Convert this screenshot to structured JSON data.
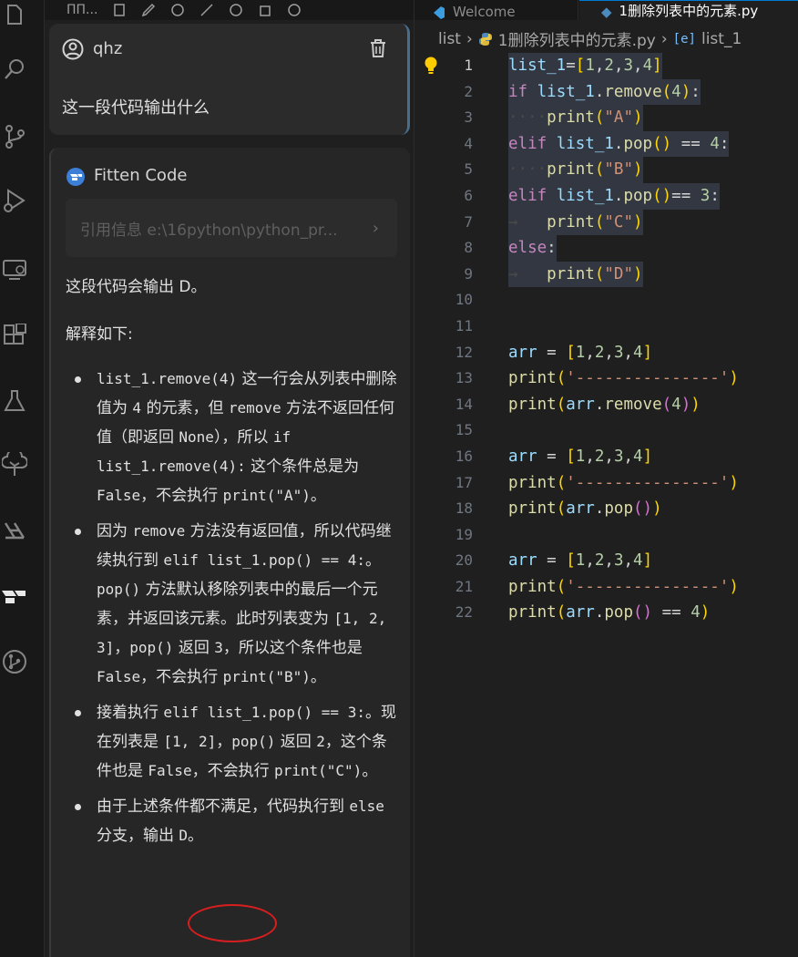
{
  "chat_toolbar": {
    "title": "ΠΠ..."
  },
  "user_card": {
    "name": "qhz",
    "message": "这一段代码输出什么"
  },
  "ai_card": {
    "name": "Fitten Code",
    "reference": "引用信息 e:\\16python\\python_pr...",
    "summary": "这段代码会输出 D。",
    "heading": "解释如下:",
    "bullets": [
      {
        "segments": [
          {
            "t": "list_1.remove(4)",
            "c": true
          },
          {
            "t": " 这一行会从列表中删除值为 "
          },
          {
            "t": "4",
            "c": true
          },
          {
            "t": " 的元素，但 "
          },
          {
            "t": "remove",
            "c": true
          },
          {
            "t": " 方法不返回任何值（即返回 "
          },
          {
            "t": "None",
            "c": true
          },
          {
            "t": "），所以 "
          },
          {
            "t": "if list_1.remove(4):",
            "c": true
          },
          {
            "t": " 这个条件总是为 "
          },
          {
            "t": "False",
            "c": true
          },
          {
            "t": "，不会执行 "
          },
          {
            "t": "print(\"A\")",
            "c": true
          },
          {
            "t": "。"
          }
        ]
      },
      {
        "segments": [
          {
            "t": "因为 "
          },
          {
            "t": "remove",
            "c": true
          },
          {
            "t": " 方法没有返回值，所以代码继续执行到 "
          },
          {
            "t": "elif list_1.pop() == 4:",
            "c": true
          },
          {
            "t": "。"
          },
          {
            "t": "pop()",
            "c": true
          },
          {
            "t": " 方法默认移除列表中的最后一个元素，并返回该元素。此时列表变为 "
          },
          {
            "t": "[1, 2, 3]",
            "c": true
          },
          {
            "t": "，"
          },
          {
            "t": "pop()",
            "c": true
          },
          {
            "t": " 返回 "
          },
          {
            "t": "3",
            "c": true
          },
          {
            "t": "，所以这个条件也是 "
          },
          {
            "t": "False",
            "c": true
          },
          {
            "t": "，不会执行 "
          },
          {
            "t": "print(\"B\")",
            "c": true
          },
          {
            "t": "。"
          }
        ]
      },
      {
        "segments": [
          {
            "t": "接着执行 "
          },
          {
            "t": "elif list_1.pop() == 3:",
            "c": true
          },
          {
            "t": "。现在列表是 "
          },
          {
            "t": "[1, 2]",
            "c": true
          },
          {
            "t": "，"
          },
          {
            "t": "pop()",
            "c": true
          },
          {
            "t": " 返回 "
          },
          {
            "t": "2",
            "c": true
          },
          {
            "t": "，这个条件也是 "
          },
          {
            "t": "False",
            "c": true
          },
          {
            "t": "，不会执行 "
          },
          {
            "t": "print(\"C\")",
            "c": true
          },
          {
            "t": "。"
          }
        ]
      },
      {
        "segments": [
          {
            "t": "由于上述条件都不满足，代码执行到 "
          },
          {
            "t": "else",
            "c": true
          },
          {
            "t": " 分支，输出 "
          },
          {
            "t": "D",
            "c": true
          },
          {
            "t": "。"
          }
        ]
      }
    ]
  },
  "editor": {
    "tabs": [
      "Welcome",
      "1删除列表中的元素.py"
    ],
    "breadcrumb": {
      "folder": "list",
      "file": "1删除列表中的元素.py",
      "symbol": "list_1"
    },
    "active_line": 1,
    "lines": [
      {
        "n": "1",
        "sel": true,
        "tokens": [
          [
            "v",
            "list_1"
          ],
          [
            "p",
            "="
          ],
          [
            "b1",
            "["
          ],
          [
            "n",
            "1"
          ],
          [
            "p",
            ","
          ],
          [
            "n",
            "2"
          ],
          [
            "p",
            ","
          ],
          [
            "n",
            "3"
          ],
          [
            "p",
            ","
          ],
          [
            "n",
            "4"
          ],
          [
            "b1",
            "]"
          ]
        ]
      },
      {
        "n": "2",
        "sel": true,
        "tokens": [
          [
            "k",
            "if"
          ],
          [
            "p",
            " "
          ],
          [
            "v",
            "list_1"
          ],
          [
            "p",
            "."
          ],
          [
            "f",
            "remove"
          ],
          [
            "b1",
            "("
          ],
          [
            "n",
            "4"
          ],
          [
            "b1",
            ")"
          ],
          [
            "p",
            ":"
          ]
        ]
      },
      {
        "n": "3",
        "sel": true,
        "tokens": [
          [
            "ws",
            "····"
          ],
          [
            "f",
            "print"
          ],
          [
            "b1",
            "("
          ],
          [
            "s",
            "\"A\""
          ],
          [
            "b1",
            ")"
          ]
        ]
      },
      {
        "n": "4",
        "sel": true,
        "tokens": [
          [
            "k",
            "elif"
          ],
          [
            "p",
            " "
          ],
          [
            "v",
            "list_1"
          ],
          [
            "p",
            "."
          ],
          [
            "f",
            "pop"
          ],
          [
            "b1",
            "("
          ],
          [
            "b1",
            ")"
          ],
          [
            "p",
            " == "
          ],
          [
            "n",
            "4"
          ],
          [
            "p",
            ":"
          ]
        ]
      },
      {
        "n": "5",
        "sel": true,
        "tokens": [
          [
            "ws",
            "····"
          ],
          [
            "f",
            "print"
          ],
          [
            "b1",
            "("
          ],
          [
            "s",
            "\"B\""
          ],
          [
            "b1",
            ")"
          ]
        ]
      },
      {
        "n": "6",
        "sel": true,
        "tokens": [
          [
            "k",
            "elif"
          ],
          [
            "p",
            " "
          ],
          [
            "v",
            "list_1"
          ],
          [
            "p",
            "."
          ],
          [
            "f",
            "pop"
          ],
          [
            "b1",
            "("
          ],
          [
            "b1",
            ")"
          ],
          [
            "p",
            "== "
          ],
          [
            "n",
            "3"
          ],
          [
            "p",
            ":"
          ]
        ]
      },
      {
        "n": "7",
        "sel": true,
        "tokens": [
          [
            "ws",
            "→   "
          ],
          [
            "f",
            "print"
          ],
          [
            "b1",
            "("
          ],
          [
            "s",
            "\"C\""
          ],
          [
            "b1",
            ")"
          ]
        ]
      },
      {
        "n": "8",
        "sel": true,
        "tokens": [
          [
            "k",
            "else"
          ],
          [
            "p",
            ":"
          ]
        ]
      },
      {
        "n": "9",
        "sel": true,
        "tokens": [
          [
            "ws",
            "→   "
          ],
          [
            "f",
            "print"
          ],
          [
            "b1",
            "("
          ],
          [
            "s",
            "\"D\""
          ],
          [
            "b1",
            ")"
          ]
        ]
      },
      {
        "n": "10",
        "sel": false,
        "tokens": []
      },
      {
        "n": "11",
        "sel": false,
        "tokens": []
      },
      {
        "n": "12",
        "sel": false,
        "tokens": [
          [
            "v",
            "arr"
          ],
          [
            "p",
            " = "
          ],
          [
            "b1",
            "["
          ],
          [
            "n",
            "1"
          ],
          [
            "p",
            ","
          ],
          [
            "n",
            "2"
          ],
          [
            "p",
            ","
          ],
          [
            "n",
            "3"
          ],
          [
            "p",
            ","
          ],
          [
            "n",
            "4"
          ],
          [
            "b1",
            "]"
          ]
        ]
      },
      {
        "n": "13",
        "sel": false,
        "tokens": [
          [
            "f",
            "print"
          ],
          [
            "b1",
            "("
          ],
          [
            "s",
            "'---------------'"
          ],
          [
            "b1",
            ")"
          ]
        ]
      },
      {
        "n": "14",
        "sel": false,
        "tokens": [
          [
            "f",
            "print"
          ],
          [
            "b1",
            "("
          ],
          [
            "v",
            "arr"
          ],
          [
            "p",
            "."
          ],
          [
            "f",
            "remove"
          ],
          [
            "b2",
            "("
          ],
          [
            "n",
            "4"
          ],
          [
            "b2",
            ")"
          ],
          [
            "b1",
            ")"
          ]
        ]
      },
      {
        "n": "15",
        "sel": false,
        "tokens": []
      },
      {
        "n": "16",
        "sel": false,
        "tokens": [
          [
            "v",
            "arr"
          ],
          [
            "p",
            " = "
          ],
          [
            "b1",
            "["
          ],
          [
            "n",
            "1"
          ],
          [
            "p",
            ","
          ],
          [
            "n",
            "2"
          ],
          [
            "p",
            ","
          ],
          [
            "n",
            "3"
          ],
          [
            "p",
            ","
          ],
          [
            "n",
            "4"
          ],
          [
            "b1",
            "]"
          ]
        ]
      },
      {
        "n": "17",
        "sel": false,
        "tokens": [
          [
            "f",
            "print"
          ],
          [
            "b1",
            "("
          ],
          [
            "s",
            "'---------------'"
          ],
          [
            "b1",
            ")"
          ]
        ]
      },
      {
        "n": "18",
        "sel": false,
        "tokens": [
          [
            "f",
            "print"
          ],
          [
            "b1",
            "("
          ],
          [
            "v",
            "arr"
          ],
          [
            "p",
            "."
          ],
          [
            "f",
            "pop"
          ],
          [
            "b2",
            "("
          ],
          [
            "b2",
            ")"
          ],
          [
            "b1",
            ")"
          ]
        ]
      },
      {
        "n": "19",
        "sel": false,
        "tokens": []
      },
      {
        "n": "20",
        "sel": false,
        "tokens": [
          [
            "v",
            "arr"
          ],
          [
            "p",
            " = "
          ],
          [
            "b1",
            "["
          ],
          [
            "n",
            "1"
          ],
          [
            "p",
            ","
          ],
          [
            "n",
            "2"
          ],
          [
            "p",
            ","
          ],
          [
            "n",
            "3"
          ],
          [
            "p",
            ","
          ],
          [
            "n",
            "4"
          ],
          [
            "b1",
            "]"
          ]
        ]
      },
      {
        "n": "21",
        "sel": false,
        "tokens": [
          [
            "f",
            "print"
          ],
          [
            "b1",
            "("
          ],
          [
            "s",
            "'---------------'"
          ],
          [
            "b1",
            ")"
          ]
        ]
      },
      {
        "n": "22",
        "sel": false,
        "tokens": [
          [
            "f",
            "print"
          ],
          [
            "b1",
            "("
          ],
          [
            "v",
            "arr"
          ],
          [
            "p",
            "."
          ],
          [
            "f",
            "pop"
          ],
          [
            "b2",
            "("
          ],
          [
            "b2",
            ")"
          ],
          [
            "p",
            " == "
          ],
          [
            "n",
            "4"
          ],
          [
            "b1",
            ")"
          ]
        ]
      }
    ]
  },
  "colors": {
    "accent": "#0078d4",
    "annotation_circle": "#d81e1e",
    "keyword": "#c586c0",
    "string": "#ce9178",
    "number": "#b5cea8"
  },
  "icons": {
    "activity_bar": [
      "explorer-icon",
      "search-icon",
      "source-control-icon",
      "run-debug-icon",
      "remote-explorer-icon",
      "extensions-icon",
      "testing-icon",
      "tree-icon",
      "python-icon",
      "fitten-icon",
      "git-graph-icon"
    ]
  }
}
